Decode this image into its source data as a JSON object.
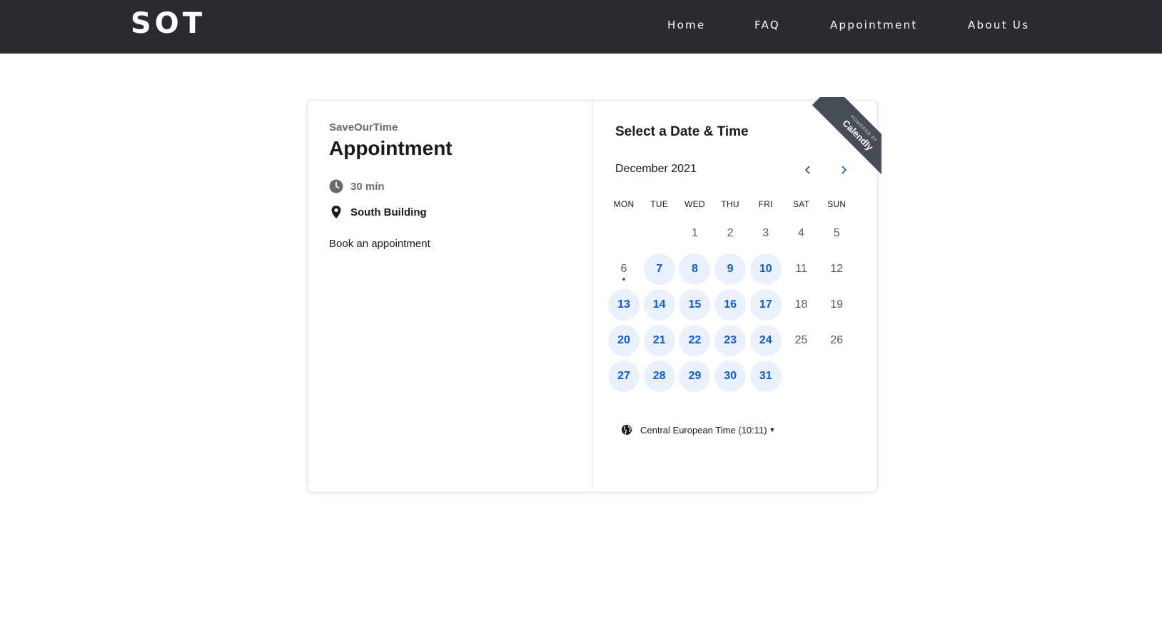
{
  "header": {
    "logo": "SOT",
    "nav": [
      "Home",
      "FAQ",
      "Appointment",
      "About Us"
    ]
  },
  "event": {
    "organization": "SaveOurTime",
    "title": "Appointment",
    "duration": "30 min",
    "location": "South Building",
    "description": "Book an appointment"
  },
  "calendar": {
    "heading": "Select a Date & Time",
    "month": "December 2021",
    "weekdays": [
      "MON",
      "TUE",
      "WED",
      "THU",
      "FRI",
      "SAT",
      "SUN"
    ],
    "first_weekday_index": 2,
    "days_in_month": 31,
    "today": 6,
    "available_days": [
      7,
      8,
      9,
      10,
      13,
      14,
      15,
      16,
      17,
      20,
      21,
      22,
      23,
      24,
      27,
      28,
      29,
      30,
      31
    ],
    "timezone": "Central European Time (10:11)"
  },
  "badge": {
    "small": "POWERED BY",
    "big": "Calendly"
  },
  "colors": {
    "header_bg": "#2b2a30",
    "accent": "#0a5ad9",
    "available_bg": "#eaf1fd",
    "ribbon": "#474d56"
  }
}
